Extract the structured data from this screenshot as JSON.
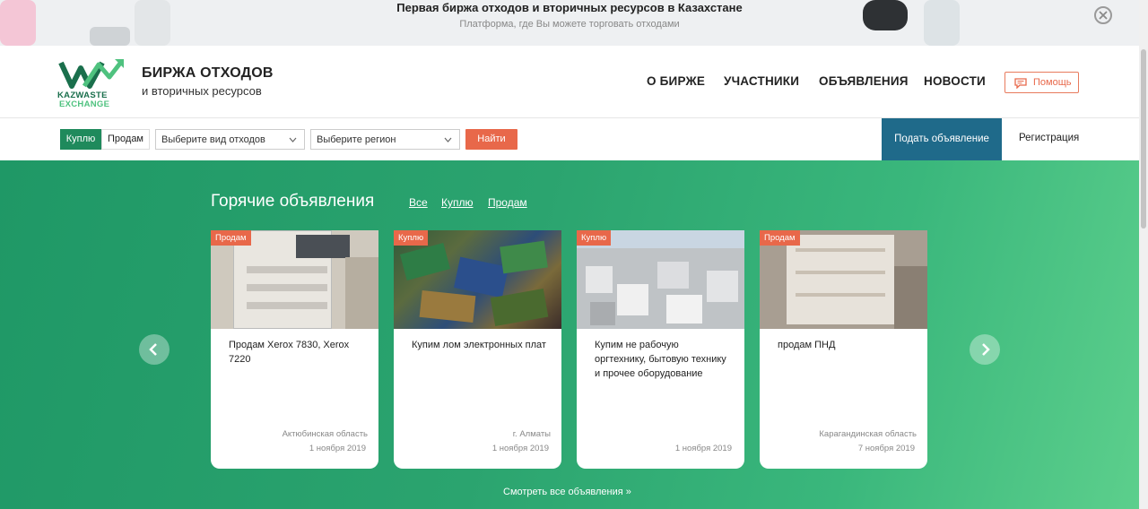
{
  "promo": {
    "title": "Первая биржа отходов и вторичных ресурсов в Казахстане",
    "subtitle": "Платформа, где Вы можете торговать отходами"
  },
  "brand": {
    "logo_line1": "KAZWASTE",
    "logo_line2": "EXCHANGE",
    "title": "БИРЖА ОТХОДОВ",
    "subtitle": "и вторичных ресурсов"
  },
  "nav": {
    "about": "О БИРЖЕ",
    "members": "УЧАСТНИКИ",
    "ads": "ОБЪЯВЛЕНИЯ",
    "news": "НОВОСТИ",
    "help": "Помощь"
  },
  "search": {
    "buy": "Куплю",
    "sell": "Продам",
    "waste_type": "Выберите вид отходов",
    "region": "Выберите регион",
    "find": "Найти",
    "post_ad": "Подать объявление",
    "register": "Регистрация"
  },
  "hot": {
    "title": "Горячие объявления",
    "filter_all": "Все",
    "filter_buy": "Куплю",
    "filter_sell": "Продам",
    "see_all": "Смотреть все объявления »"
  },
  "cards": [
    {
      "badge": "Продам",
      "title": "Продам Xerox 7830, Xerox 7220",
      "region": "Актюбинская область",
      "date": "1 ноября 2019"
    },
    {
      "badge": "Куплю",
      "title": "Купим лом электронных плат",
      "region": "г. Алматы",
      "date": "1 ноября 2019"
    },
    {
      "badge": "Куплю",
      "title": "Купим не рабочую оргтехнику, бытовую технику и прочее оборудование",
      "region": "",
      "date": "1 ноября 2019"
    },
    {
      "badge": "Продам",
      "title": "продам ПНД",
      "region": "Карагандинская область",
      "date": "7 ноября 2019"
    }
  ],
  "colors": {
    "brand_green": "#1f8a5c",
    "accent_orange": "#e8684a",
    "post_button_blue": "#1f6a8a"
  }
}
